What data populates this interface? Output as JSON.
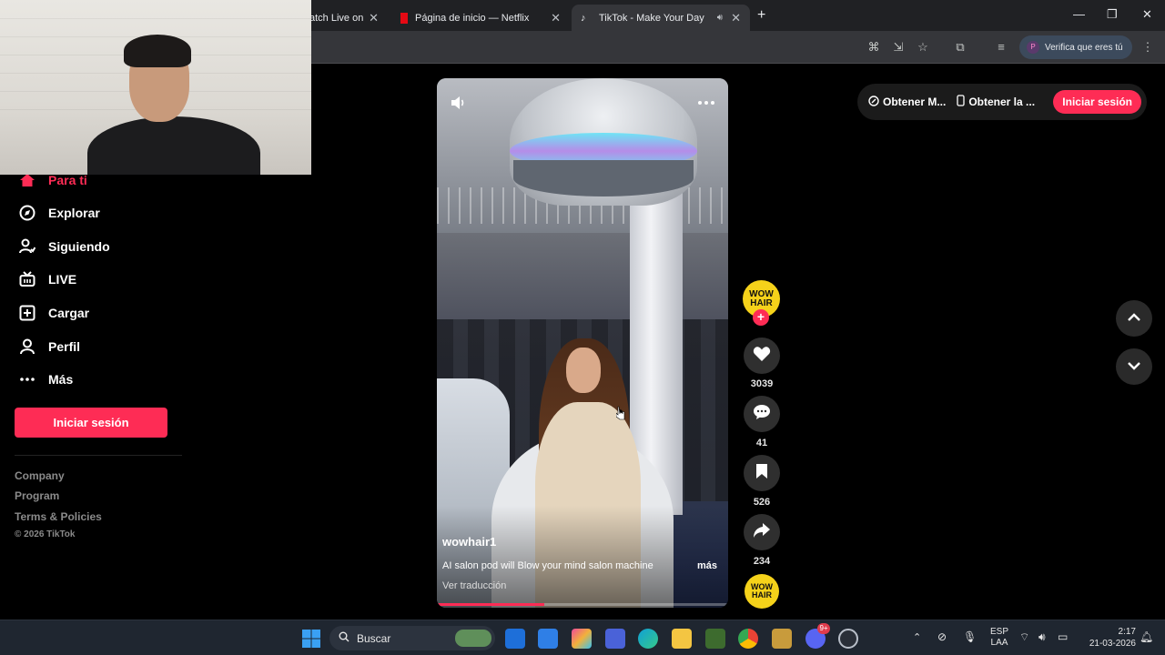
{
  "browser": {
    "tabs": [
      {
        "title": "atch Live on",
        "active": false
      },
      {
        "title": "Página de inicio — Netflix",
        "active": false
      },
      {
        "title": "TikTok - Make Your Day",
        "active": true
      }
    ],
    "profile_label": "Verifica que eres tú",
    "profile_initial": "P"
  },
  "sidebar": {
    "items": [
      {
        "label": "Para ti",
        "icon": "home-icon",
        "active": true
      },
      {
        "label": "Explorar",
        "icon": "compass-icon"
      },
      {
        "label": "Siguiendo",
        "icon": "following-icon"
      },
      {
        "label": "LIVE",
        "icon": "live-icon"
      },
      {
        "label": "Cargar",
        "icon": "upload-icon"
      },
      {
        "label": "Perfil",
        "icon": "profile-icon"
      },
      {
        "label": "Más",
        "icon": "more-icon"
      }
    ],
    "login_label": "Iniciar sesión",
    "footer_links": [
      "Company",
      "Program",
      "Terms & Policies"
    ],
    "copyright": "© 2026 TikTok"
  },
  "video": {
    "username": "wowhair1",
    "caption": "AI salon pod will Blow your mind salon machine",
    "more_label": "más",
    "translate_label": "Ver traducción",
    "progress": 0.37
  },
  "actions": {
    "avatar_text": "WOW HAIR",
    "likes": "3039",
    "comments": "41",
    "saves": "526",
    "shares": "234"
  },
  "topbar": {
    "item1": "Obtener M...",
    "item2": "Obtener la ...",
    "login": "Iniciar sesión"
  },
  "taskbar": {
    "search_label": "Buscar",
    "lang_line1": "ESP",
    "lang_line2": "LAA",
    "time": "2:17",
    "date": "21-03-2026",
    "badge": "9+"
  },
  "colors": {
    "accent": "#fe2c55",
    "avatar_yellow": "#f5d21a"
  }
}
